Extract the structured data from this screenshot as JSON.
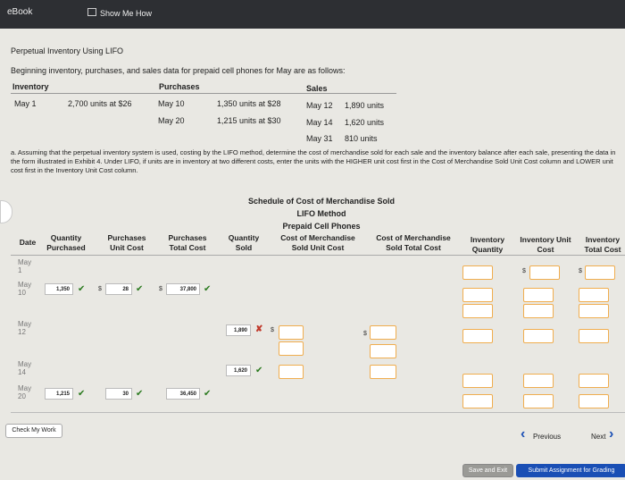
{
  "topbar": {
    "ebook": "eBook",
    "show_me_how": "Show Me How"
  },
  "title": "Perpetual Inventory Using LIFO",
  "intro": "Beginning inventory, purchases, and sales data for prepaid cell phones for May are as follows:",
  "data_table": {
    "headers": {
      "inventory": "Inventory",
      "purchases": "Purchases",
      "sales": "Sales"
    },
    "inventory": {
      "date": "May 1",
      "desc": "2,700 units at $26"
    },
    "purchases": [
      {
        "date": "May 10",
        "desc": "1,350 units at $28"
      },
      {
        "date": "May 20",
        "desc": "1,215 units at $30"
      }
    ],
    "sales": [
      {
        "date": "May 12",
        "units": "1,890 units"
      },
      {
        "date": "May 14",
        "units": "1,620 units"
      },
      {
        "date": "May 31",
        "units": "810 units"
      }
    ]
  },
  "instruction": "a. Assuming that the perpetual inventory system is used, costing by the LIFO method, determine the cost of merchandise sold for each sale and the inventory balance after each sale, presenting the data in the form illustrated in Exhibit 4. Under LIFO, if units are in inventory at two different costs, enter the units with the HIGHER unit cost first in the Cost of Merchandise Sold Unit Cost column and LOWER unit cost first in the Inventory Unit Cost column.",
  "schedule": {
    "title1": "Schedule of Cost of Merchandise Sold",
    "title2": "LIFO Method",
    "title3": "Prepaid Cell Phones",
    "columns": {
      "date": "Date",
      "qty_purchased": "Quantity Purchased",
      "purch_unit_cost": "Purchases Unit Cost",
      "purch_total_cost": "Purchases Total Cost",
      "qty_sold": "Quantity Sold",
      "cms_unit_cost": "Cost of Merchandise Sold Unit Cost",
      "cms_total_cost": "Cost of Merchandise Sold Total Cost",
      "inv_qty": "Inventory Quantity",
      "inv_unit_cost": "Inventory Unit Cost",
      "inv_total_cost": "Inventory Total Cost"
    },
    "dates": [
      "May 1",
      "May 10",
      "May 12",
      "May 14",
      "May 20"
    ],
    "values": {
      "may10_qty": "1,350",
      "may10_unit": "28",
      "may10_total": "37,800",
      "may12_sold": "1,890",
      "may14_sold": "1,620",
      "may20_qty": "1,215",
      "may20_unit": "30",
      "may20_total": "36,450"
    }
  },
  "buttons": {
    "check_my_work": "Check My Work",
    "previous": "Previous",
    "next": "Next",
    "save_and_exit": "Save and Exit",
    "submit": "Submit Assignment for Grading"
  }
}
